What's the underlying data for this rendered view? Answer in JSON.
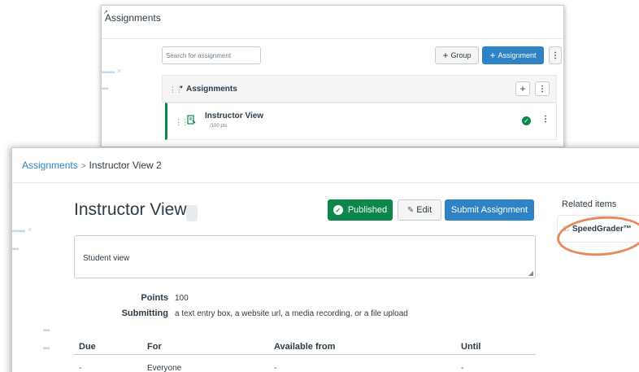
{
  "top_window": {
    "title": "Assignments",
    "search": {
      "placeholder": "Search for assignment"
    },
    "toolbar": {
      "group_label": "Group",
      "assignment_label": "Assignment"
    },
    "group": {
      "name": "Assignments"
    },
    "assignment_row": {
      "name": "Instructor View",
      "points": "/100 pts"
    }
  },
  "breadcrumb": {
    "root": "Assignments",
    "separator": ">",
    "current": "Instructor View 2"
  },
  "main": {
    "title": "Instructor View",
    "buttons": {
      "published": "Published",
      "edit": "Edit",
      "submit": "Submit Assignment"
    },
    "description": "Student view",
    "details": [
      {
        "label": "Points",
        "value": "100"
      },
      {
        "label": "Submitting",
        "value": "a text entry box, a website url, a media recording, or a file upload"
      }
    ],
    "table": {
      "headers": [
        "Due",
        "For",
        "Available from",
        "Until"
      ],
      "rows": [
        [
          "-",
          "Everyone",
          "-",
          "-"
        ]
      ]
    }
  },
  "related": {
    "title": "Related items",
    "speedgrader": "SpeedGrader™"
  },
  "colors": {
    "primary": "#2d83c5",
    "success": "#0b874b",
    "highlight": "#e88a5c"
  }
}
